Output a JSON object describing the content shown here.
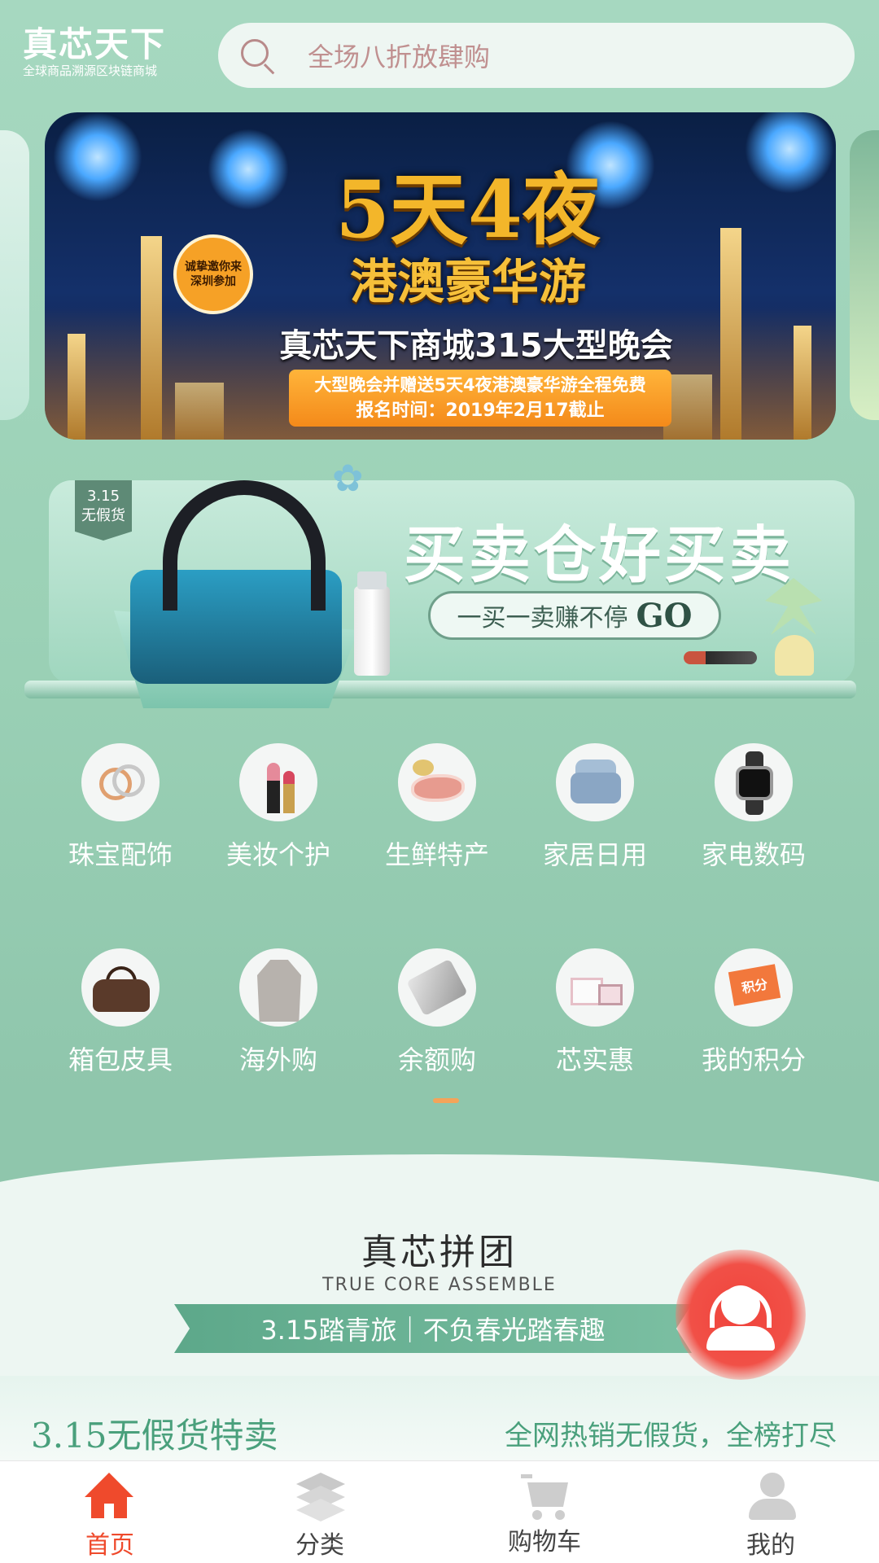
{
  "header": {
    "logo_main": "真芯天下",
    "logo_sub": "全球商品溯源区块链商城",
    "search_placeholder": "全场八折放肆购",
    "search_icon": "search-icon"
  },
  "banner": {
    "headline": "5天4夜",
    "subline": "港澳豪华游",
    "badge_line1": "诚挚邀你来",
    "badge_line2": "深圳参加",
    "title": "真芯天下商城315大型晚会",
    "box_line1": "大型晚会并赠送5天4夜港澳豪华游全程免费",
    "box_line2": "报名时间：2019年2月17截止"
  },
  "promo": {
    "tag_line1": "3.15",
    "tag_line2": "无假货",
    "title": "买卖仓好买卖",
    "pill_text": "一买一卖赚不停",
    "pill_go": "GO"
  },
  "categories": [
    {
      "label": "珠宝配饰",
      "icon": "jewelry-ring-icon"
    },
    {
      "label": "美妆个护",
      "icon": "lipstick-icon"
    },
    {
      "label": "生鲜特产",
      "icon": "fresh-food-icon"
    },
    {
      "label": "家居日用",
      "icon": "sofa-icon"
    },
    {
      "label": "家电数码",
      "icon": "smartwatch-icon"
    },
    {
      "label": "箱包皮具",
      "icon": "handbag-icon"
    },
    {
      "label": "海外购",
      "icon": "coat-icon"
    },
    {
      "label": "余额购",
      "icon": "card-icon"
    },
    {
      "label": "芯实惠",
      "icon": "gift-box-icon"
    },
    {
      "label": "我的积分",
      "icon": "points-icon",
      "icon_text": "积分"
    }
  ],
  "group": {
    "title": "真芯拼团",
    "subtitle": "TRUE CORE ASSEMBLE",
    "ribbon": "3.15踏青旅｜不负春光踏春趣"
  },
  "strip": {
    "left": "3.15无假货特卖",
    "right": "全网热销无假货，全榜打尽"
  },
  "tabbar": {
    "tabs": [
      {
        "label": "首页",
        "icon": "home-icon",
        "active": true
      },
      {
        "label": "分类",
        "icon": "category-layers-icon",
        "active": false
      },
      {
        "label": "购物车",
        "icon": "cart-icon",
        "active": false
      },
      {
        "label": "我的",
        "icon": "user-icon",
        "active": false
      }
    ]
  },
  "colors": {
    "accent": "#ef4a2c",
    "page_green": "#9bd1b6",
    "label_white": "#ffffff",
    "search_text": "#c09090",
    "pager_dot": "#f4a45a",
    "fab_red": "#f0433b"
  }
}
